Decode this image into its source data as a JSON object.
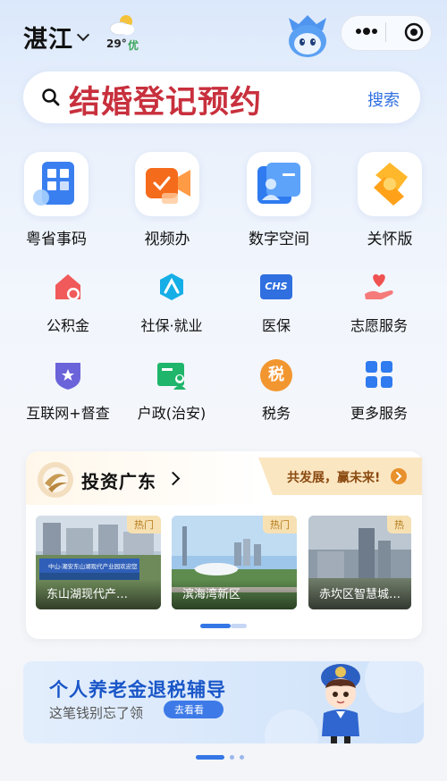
{
  "header": {
    "city": "湛江",
    "weather": {
      "temp": "29°",
      "aqi": "优",
      "icon": "partly-cloudy-icon"
    }
  },
  "search": {
    "text": "结婚登记预约",
    "button": "搜索"
  },
  "quick_services": [
    {
      "label": "粤省事码",
      "icon": "qr-code-icon"
    },
    {
      "label": "视频办",
      "icon": "video-camera-icon"
    },
    {
      "label": "数字空间",
      "icon": "digital-space-icon"
    },
    {
      "label": "关怀版",
      "icon": "care-ribbon-icon"
    }
  ],
  "services": [
    {
      "label": "公积金",
      "icon": "housing-fund-icon"
    },
    {
      "label": "社保·就业",
      "icon": "social-security-icon"
    },
    {
      "label": "医保",
      "icon": "chs-medical-insurance-icon",
      "icon_text": "CHS"
    },
    {
      "label": "志愿服务",
      "icon": "volunteer-heart-icon"
    },
    {
      "label": "互联网+督查",
      "icon": "supervision-shield-icon"
    },
    {
      "label": "户政(治安)",
      "icon": "household-id-icon"
    },
    {
      "label": "税务",
      "icon": "tax-icon",
      "icon_text": "税"
    },
    {
      "label": "更多服务",
      "icon": "more-grid-icon"
    }
  ],
  "invest": {
    "title": "投资广东",
    "slogan": "共发展，赢未来!",
    "cards": [
      {
        "tag": "热门",
        "caption": "东山湖现代产…",
        "sign": "中山-潮安东山湖现代产业园欢迎您"
      },
      {
        "tag": "热门",
        "caption": "滨海湾新区"
      },
      {
        "tag": "热",
        "caption": "赤坎区智慧城…"
      }
    ],
    "pager": {
      "count": 2,
      "active": 0
    }
  },
  "banner": {
    "title": "个人养老金退税辅导",
    "subtitle": "这笔钱别忘了领",
    "button": "去看看",
    "pager": {
      "count": 3,
      "active": 0
    }
  },
  "colors": {
    "accent_blue": "#3476e6",
    "search_text": "#c8303d",
    "aqi_green": "#3aa75b",
    "hot_tag": "#f7e1b3"
  }
}
